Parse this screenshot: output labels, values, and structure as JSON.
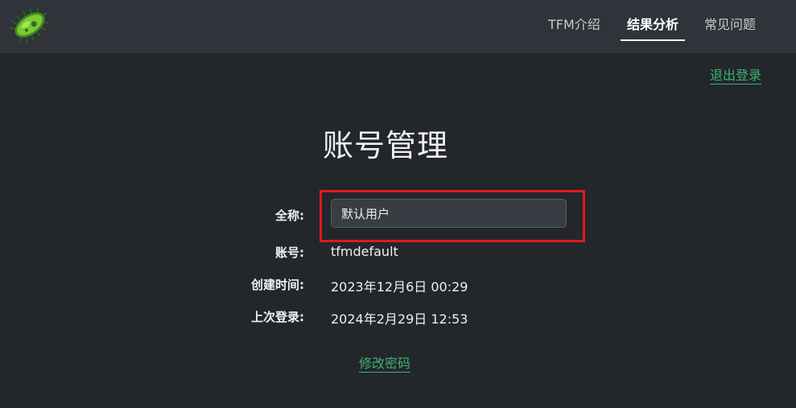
{
  "nav": {
    "logo_icon": "bacterium-logo-icon",
    "items": [
      {
        "label": "TFM介绍",
        "active": false
      },
      {
        "label": "结果分析",
        "active": true
      },
      {
        "label": "常见问题",
        "active": false
      }
    ]
  },
  "logout_label": "退出登录",
  "page_title": "账号管理",
  "form": {
    "fullname_label": "全称:",
    "fullname_value": "默认用户",
    "account_label": "账号:",
    "account_value": "tfmdefault",
    "created_label": "创建时间:",
    "created_value": "2023年12月6日 00:29",
    "lastlogin_label": "上次登录:",
    "lastlogin_value": "2024年2月29日 12:53"
  },
  "change_password_label": "修改密码",
  "colors": {
    "background": "#23262b",
    "navbar": "#30343a",
    "link_green": "#3cb371",
    "highlight_red": "#e0191c"
  }
}
